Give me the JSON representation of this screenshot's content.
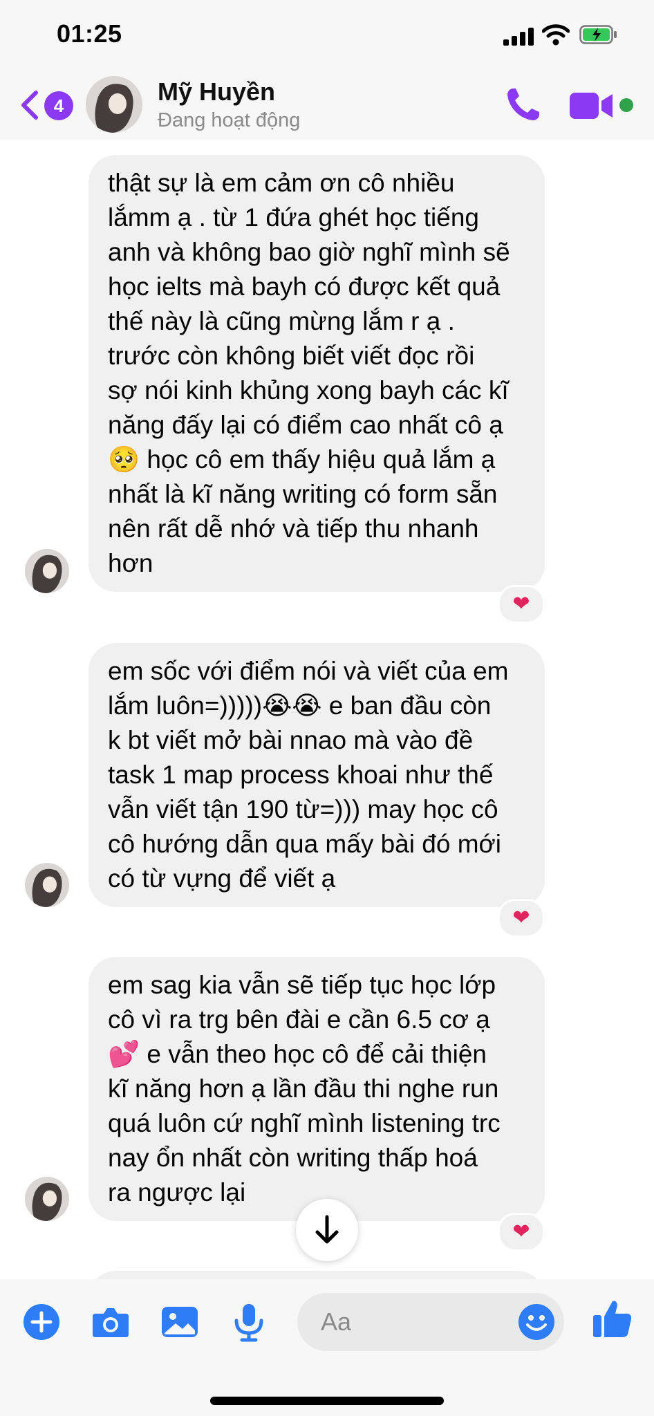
{
  "status_bar": {
    "time": "01:25"
  },
  "header": {
    "back_badge": "4",
    "contact_name": "Mỹ Huyền",
    "contact_status": "Đang hoạt động"
  },
  "messages": [
    {
      "text": "thật sự là em cảm ơn cô nhiều\nlắmm ạ . từ 1 đứa ghét học tiếng\nanh và không bao giờ nghĩ mình sẽ\nhọc ielts mà bayh có được kết quả\nthế này là cũng mừng lắm r ạ .\ntrước còn không biết viết đọc rồi\nsợ nói kinh khủng xong bayh các kĩ\nnăng đấy lại có điểm cao nhất cô ạ\n🥺 học cô em thấy hiệu quả lắm ạ\nnhất là kĩ năng writing có form sẵn\nnên rất dễ nhớ và tiếp thu nhanh\nhơn",
      "reaction": "❤"
    },
    {
      "text": "em sốc với điểm nói và viết của em\nlắm luôn=)))))😭😭 e ban đầu còn\nk bt viết mở bài nnao mà vào đề\ntask 1  map process khoai như thế\nvẫn viết tận 190 từ=))) may học cô\ncô hướng dẫn qua mấy bài đó mới\ncó từ vựng để viết ạ",
      "reaction": "❤"
    },
    {
      "text": "em sag kia vẫn sẽ tiếp tục học lớp\ncô vì ra trg bên đài e cần 6.5 cơ ạ\n💕 e vẫn theo học cô để cải thiện\nkĩ năng hơn ạ lần đầu thi nghe run\nquá luôn cứ nghĩ mình listening trc\nnay ổn nhất còn writing thấp hoá\nra ngược lại",
      "reaction": "❤"
    }
  ],
  "composer": {
    "placeholder": "Aa"
  },
  "colors": {
    "accent": "#8b39f2",
    "tool_blue": "#2e7cf6",
    "bubble": "#f0f0f0",
    "reaction": "#e0245e"
  }
}
